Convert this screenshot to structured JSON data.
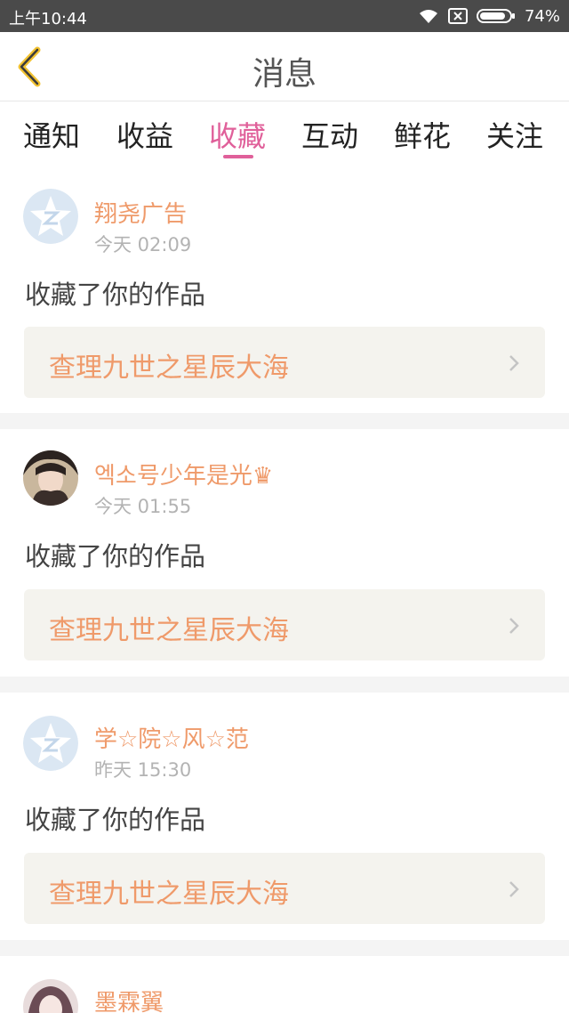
{
  "status_bar": {
    "time": "上午10:44",
    "battery": "74%",
    "icons": [
      "wifi-icon",
      "sim-disabled-icon",
      "battery-icon"
    ]
  },
  "header": {
    "title": "消息",
    "back_icon": "chevron-left-icon"
  },
  "tabs": [
    {
      "label": "通知",
      "active": false
    },
    {
      "label": "收益",
      "active": false
    },
    {
      "label": "收藏",
      "active": true
    },
    {
      "label": "互动",
      "active": false
    },
    {
      "label": "鲜花",
      "active": false
    },
    {
      "label": "关注",
      "active": false
    }
  ],
  "messages": [
    {
      "username": "翔尧广告",
      "time": "今天 02:09",
      "action": "收藏了你的作品",
      "work": "查理九世之星辰大海",
      "avatar": "default-avatar-icon"
    },
    {
      "username": "엑소号少年是光♛",
      "time": "今天 01:55",
      "action": "收藏了你的作品",
      "work": "查理九世之星辰大海",
      "avatar": "user-photo"
    },
    {
      "username": "学☆院☆风☆范",
      "time": "昨天 15:30",
      "action": "收藏了你的作品",
      "work": "查理九世之星辰大海",
      "avatar": "default-avatar-icon"
    },
    {
      "username": "墨霖翼",
      "avatar": "user-photo"
    }
  ],
  "colors": {
    "accent": "#e0609a",
    "username": "#ef9a6a",
    "status_bar": "#4a4a4a",
    "back_icon": "#f2c230"
  }
}
